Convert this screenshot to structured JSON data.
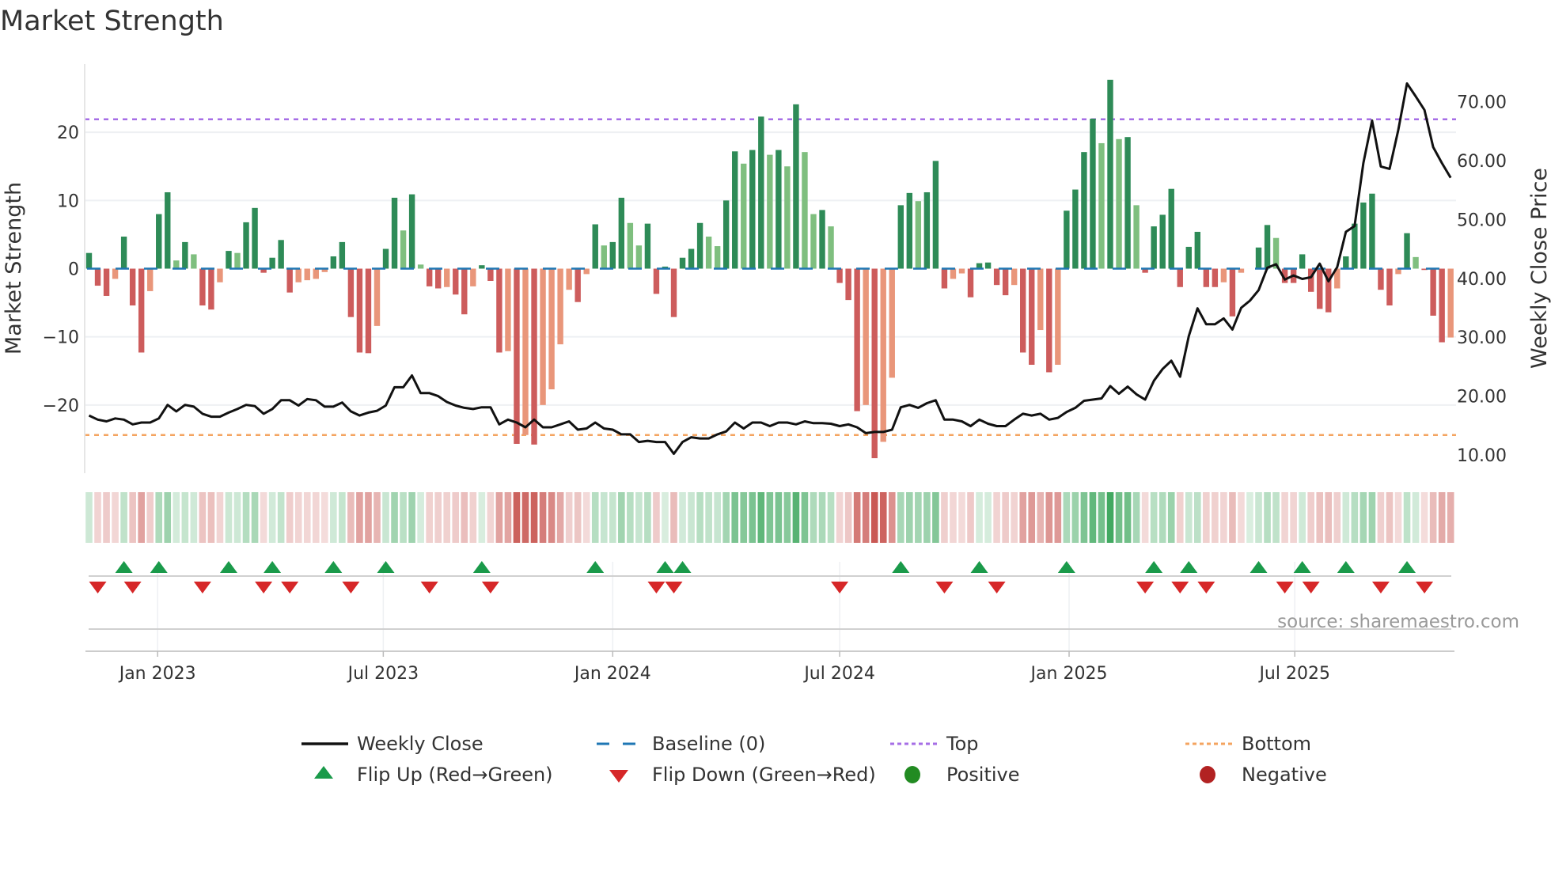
{
  "title": "Market Strength",
  "source": "source: sharemaestro.com",
  "chart_data": {
    "type": "bar",
    "title": "Market Strength",
    "ylabel": "Market Strength",
    "y2label": "Weekly Close Price",
    "x_start": "2022-11-07",
    "x_step_days": 7,
    "ylim": [
      -30,
      30
    ],
    "y2lim": [
      6.9,
      76.4
    ],
    "yticks": [
      -20,
      -10,
      0,
      10,
      20
    ],
    "ytick_labels": [
      "−20",
      "−10",
      "0",
      "10",
      "20"
    ],
    "y2ticks": [
      10,
      20,
      30,
      40,
      50,
      60,
      70
    ],
    "y2tick_labels": [
      "10.00",
      "20.00",
      "30.00",
      "40.00",
      "50.00",
      "60.00",
      "70.00"
    ],
    "xticks": [
      {
        "date": "2023-01-01",
        "label": "Jan 2023"
      },
      {
        "date": "2023-07-01",
        "label": "Jul 2023"
      },
      {
        "date": "2024-01-01",
        "label": "Jan 2024"
      },
      {
        "date": "2024-07-01",
        "label": "Jul 2024"
      },
      {
        "date": "2025-01-01",
        "label": "Jan 2025"
      },
      {
        "date": "2025-07-01",
        "label": "Jul 2025"
      }
    ],
    "grid": true,
    "top_level": 21.9,
    "bottom_level": -24.4,
    "baseline": 0,
    "legend_placement": "bottom",
    "strength": [
      2.3,
      -2.5,
      -4,
      -1.5,
      4.7,
      -5.4,
      -12.3,
      -3.3,
      8,
      11.2,
      1.2,
      3.9,
      2.1,
      -5.4,
      -6,
      -2,
      2.6,
      2.3,
      6.8,
      8.9,
      -0.6,
      1.6,
      4.2,
      -3.5,
      -2,
      -1.7,
      -1.5,
      -0.5,
      1.8,
      3.9,
      -7.1,
      -12.3,
      -12.4,
      -8.4,
      2.9,
      10.4,
      5.6,
      10.9,
      0.6,
      -2.6,
      -2.9,
      -2.7,
      -3.8,
      -6.7,
      -2.6,
      0.5,
      -1.8,
      -12.3,
      -12.1,
      -25.7,
      -24.4,
      -25.8,
      -20,
      -17.7,
      -11.1,
      -3.1,
      -4.9,
      -0.8,
      6.5,
      3.4,
      3.9,
      10.4,
      6.7,
      3.4,
      6.6,
      -3.7,
      0.3,
      -7.1,
      1.6,
      2.9,
      6.7,
      4.7,
      3.3,
      10,
      17.2,
      15.4,
      17.4,
      22.3,
      16.7,
      17.4,
      15,
      24.1,
      17.1,
      8,
      8.6,
      6.2,
      -2.1,
      -4.6,
      -20.9,
      -20,
      -27.8,
      -25.4,
      -16,
      9.3,
      11.1,
      9.9,
      11.2,
      15.8,
      -2.9,
      -1.5,
      -0.7,
      -4.2,
      0.8,
      0.9,
      -2.4,
      -3.9,
      -2.4,
      -12.3,
      -14.1,
      -9,
      -15.2,
      -14.1,
      8.5,
      11.6,
      17.1,
      22,
      18.4,
      27.7,
      19,
      19.3,
      9.3,
      -0.6,
      6.2,
      7.9,
      11.7,
      -2.7,
      3.2,
      5.4,
      -2.7,
      -2.7,
      -2,
      -7,
      -0.6,
      0,
      3.1,
      6.4,
      4.5,
      -2.1,
      -2.1,
      2.1,
      -3.4,
      -5.9,
      -6.4,
      -2.9,
      1.8,
      6.6,
      9.7,
      11,
      -3.1,
      -5.4,
      -0.8,
      5.2,
      1.7,
      -0.2,
      -6.9,
      -10.8,
      -10.1
    ],
    "weekly_close": [
      16.7,
      16,
      15.7,
      16.2,
      16,
      15.2,
      15.5,
      15.5,
      16.2,
      18.5,
      17.4,
      18.5,
      18.2,
      17,
      16.5,
      16.5,
      17.2,
      17.8,
      18.5,
      18.3,
      17,
      17.8,
      19.3,
      19.3,
      18.4,
      19.5,
      19.3,
      18.2,
      18.2,
      18.9,
      17.4,
      16.7,
      17.2,
      17.5,
      18.4,
      21.5,
      21.5,
      23.5,
      20.5,
      20.5,
      20,
      19,
      18.4,
      18,
      17.8,
      18.1,
      18.1,
      15.2,
      16,
      15.5,
      14.7,
      16,
      14.7,
      14.7,
      15.2,
      15.7,
      14.3,
      14.5,
      15.5,
      14.5,
      14.3,
      13.5,
      13.5,
      12.2,
      12.4,
      12.2,
      12.2,
      10.2,
      12.2,
      13,
      12.8,
      12.8,
      13.5,
      14,
      15.5,
      14.5,
      15.5,
      15.5,
      14.9,
      15.5,
      15.5,
      15.2,
      15.7,
      15.4,
      15.4,
      15.3,
      14.9,
      15.2,
      14.7,
      13.7,
      13.9,
      13.9,
      14.3,
      18.1,
      18.5,
      18,
      18.8,
      19.3,
      16,
      16,
      15.7,
      14.9,
      16,
      15.3,
      14.9,
      14.9,
      16,
      17,
      16.7,
      17,
      16,
      16.3,
      17.3,
      18,
      19.2,
      19.4,
      19.6,
      21.7,
      20.4,
      21.6,
      20.3,
      19.4,
      22.6,
      24.6,
      26,
      23.3,
      30.2,
      34.9,
      32.2,
      32.2,
      33.2,
      31.3,
      35,
      36.2,
      38,
      41.8,
      42.4,
      39.8,
      40.5,
      39.9,
      40.2,
      42.5,
      39.5,
      41.9,
      47.9,
      48.9,
      59.6,
      66.8,
      59,
      58.6,
      65.2,
      73.1,
      70.9,
      68.6,
      62.3,
      59.6,
      57.1
    ],
    "legend": [
      {
        "key": "weekly-close",
        "label": "Weekly Close"
      },
      {
        "key": "baseline",
        "label": "Baseline (0)"
      },
      {
        "key": "top",
        "label": "Top"
      },
      {
        "key": "bottom",
        "label": "Bottom"
      },
      {
        "key": "flip-up",
        "label": "Flip Up (Red→Green)"
      },
      {
        "key": "flip-down",
        "label": "Flip Down (Green→Red)"
      },
      {
        "key": "positive",
        "label": "Positive"
      },
      {
        "key": "negative",
        "label": "Negative"
      }
    ],
    "colors": {
      "pos_strong": "#2e8b57",
      "pos_weak": "#7fbf7f",
      "neg_strong": "#cd5c5c",
      "neg_weak": "#e9967a",
      "line": "#111111",
      "baseline": "#1f77b4",
      "top": "#a66ee6",
      "bottom": "#f4a460",
      "flip_up": "#1a9a4a",
      "flip_down": "#d62728",
      "positive": "#228b22",
      "negative": "#b22222",
      "grid": "#eef0f3"
    }
  }
}
